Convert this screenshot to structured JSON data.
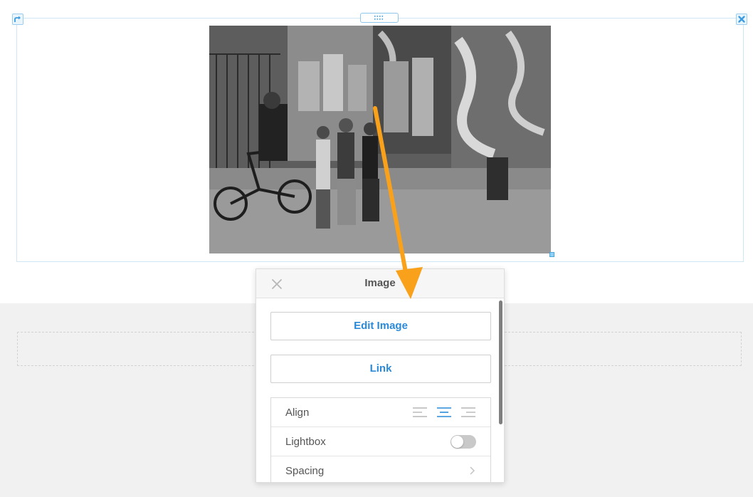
{
  "editor": {
    "block_controls": {
      "move_icon": "arrow-turn-right-icon",
      "remove_icon": "close-x-icon",
      "drag_handle_icon": "grip-dots-icon"
    }
  },
  "image_panel": {
    "title": "Image",
    "close_icon": "close-icon",
    "edit_image_label": "Edit Image",
    "link_label": "Link",
    "settings": [
      {
        "label": "Align",
        "options": [
          "left",
          "center",
          "right"
        ],
        "selected": "center"
      },
      {
        "label": "Lightbox",
        "enabled": false
      },
      {
        "label": "Spacing",
        "icon": "chevron-right-icon"
      }
    ]
  },
  "colors": {
    "accent_blue": "#2a8ad8",
    "arrow_orange": "#f9a11b",
    "frame_blue": "#cfe6f5"
  }
}
